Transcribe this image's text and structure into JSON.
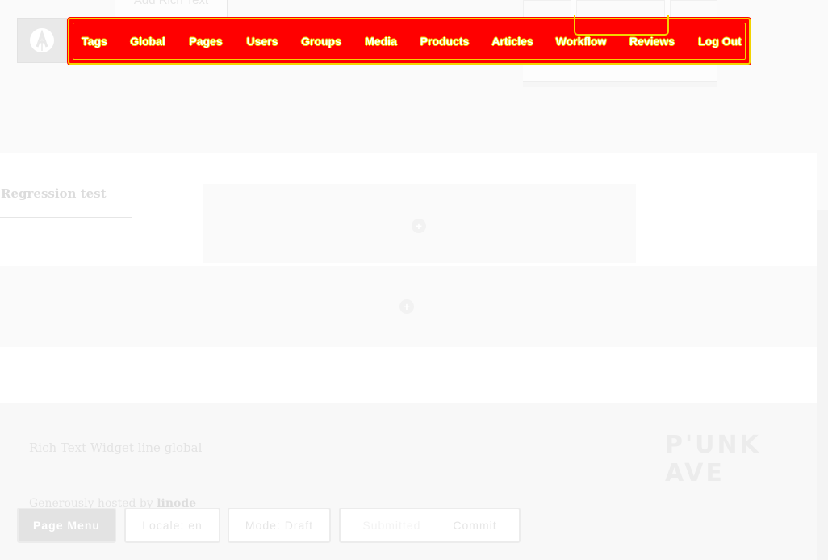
{
  "top": {
    "ghost_button_label": "Add Rich Text"
  },
  "logo": {
    "icon": "apostrophe-logo-icon"
  },
  "admin_bar": {
    "items": [
      {
        "label": "Tags"
      },
      {
        "label": "Global"
      },
      {
        "label": "Pages"
      },
      {
        "label": "Users"
      },
      {
        "label": "Groups"
      },
      {
        "label": "Media"
      },
      {
        "label": "Products"
      },
      {
        "label": "Articles"
      },
      {
        "label": "Workflow"
      },
      {
        "label": "Reviews"
      },
      {
        "label": "Log Out"
      }
    ],
    "colors": {
      "background": "#ff0000",
      "outline": "#f2d400"
    }
  },
  "content": {
    "section_title": "Regression test",
    "add_icon": "plus-icon"
  },
  "footer": {
    "text": "Rich Text Widget line global",
    "hosted_prefix": "Generously hosted by ",
    "hosted_link": "linode",
    "brand_logo": "P'UNK AVE"
  },
  "toolbar": {
    "page_menu": "Page Menu",
    "locale": "Locale: en",
    "mode": "Mode: Draft",
    "submitted": "Submitted",
    "commit": "Commit"
  }
}
